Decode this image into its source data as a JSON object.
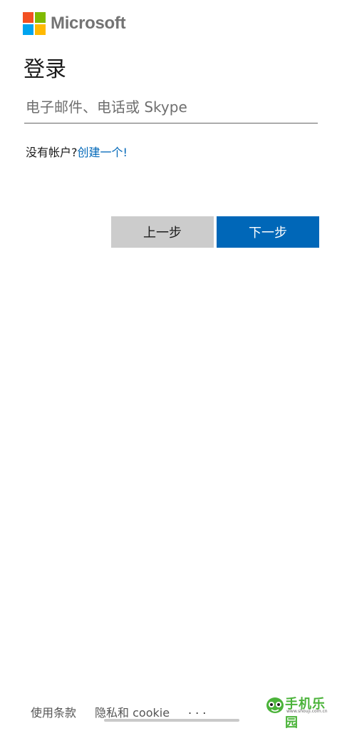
{
  "brand": {
    "name": "Microsoft",
    "colors": {
      "red": "#f25022",
      "green": "#7fba00",
      "blue": "#00a4ef",
      "yellow": "#ffb900"
    }
  },
  "page": {
    "title": "登录"
  },
  "form": {
    "email_placeholder": "电子邮件、电话或 Skype",
    "email_value": ""
  },
  "account": {
    "prompt": "没有帐户?",
    "create_link": "创建一个!"
  },
  "buttons": {
    "back": "上一步",
    "next": "下一步"
  },
  "footer": {
    "terms": "使用条款",
    "privacy": "隐私和 cookie",
    "more": "..."
  },
  "watermark": {
    "brand": "手机乐园",
    "site": "www.shouji.com.cn"
  },
  "accent_color": "#0067b8"
}
